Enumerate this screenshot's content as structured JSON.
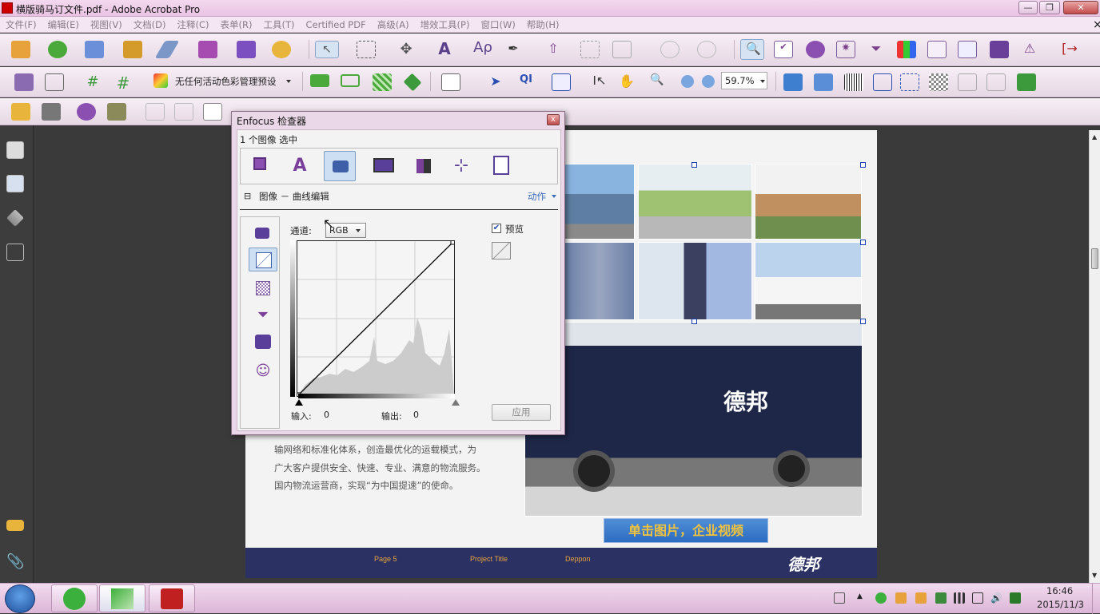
{
  "window": {
    "title": "横版骑马订文件.pdf - Adobe Acrobat Pro",
    "min": "—",
    "max": "❐",
    "close": "✕"
  },
  "menu": [
    "文件(F)",
    "编辑(E)",
    "视图(V)",
    "文档(D)",
    "注释(C)",
    "表单(R)",
    "工具(T)",
    "Certified PDF",
    "高级(A)",
    "增效工具(P)",
    "窗口(W)",
    "帮助(H)"
  ],
  "menu_close": "×",
  "toolbar2": {
    "color_preset": "无任何活动色彩管理预设",
    "zoom": "59.7%"
  },
  "dialog": {
    "title": "Enfocus 检查器",
    "close": "x",
    "selection": "1 个图像 选中",
    "section_toggle": "⊟",
    "section_title": "图像 － 曲线编辑",
    "action": "动作",
    "channel_label": "通道:",
    "channel_value": "RGB",
    "preview_label": "预览",
    "input_label": "输入:",
    "input_value": "0",
    "output_label": "输出:",
    "output_value": "0",
    "apply": "应用"
  },
  "document": {
    "body": [
      "输网络和标准化体系，创造最优化的运载模式，为",
      "广大客户提供安全、快速、专业、满意的物流服务。",
      "国内物流运营商，实现“为中国提速”的使命。"
    ],
    "video_button": "单击图片，企业视频",
    "footer": {
      "page": "Page 5",
      "project": "Project Title",
      "company": "Deppon",
      "logo": "德邦"
    },
    "truck_logo": "德邦"
  },
  "taskbar": {
    "time": "16:46",
    "date": "2015/11/3"
  },
  "colors": {
    "accent": "#2b3163",
    "selection": "#cde0f3",
    "title_bg": "#e9c3e3"
  }
}
